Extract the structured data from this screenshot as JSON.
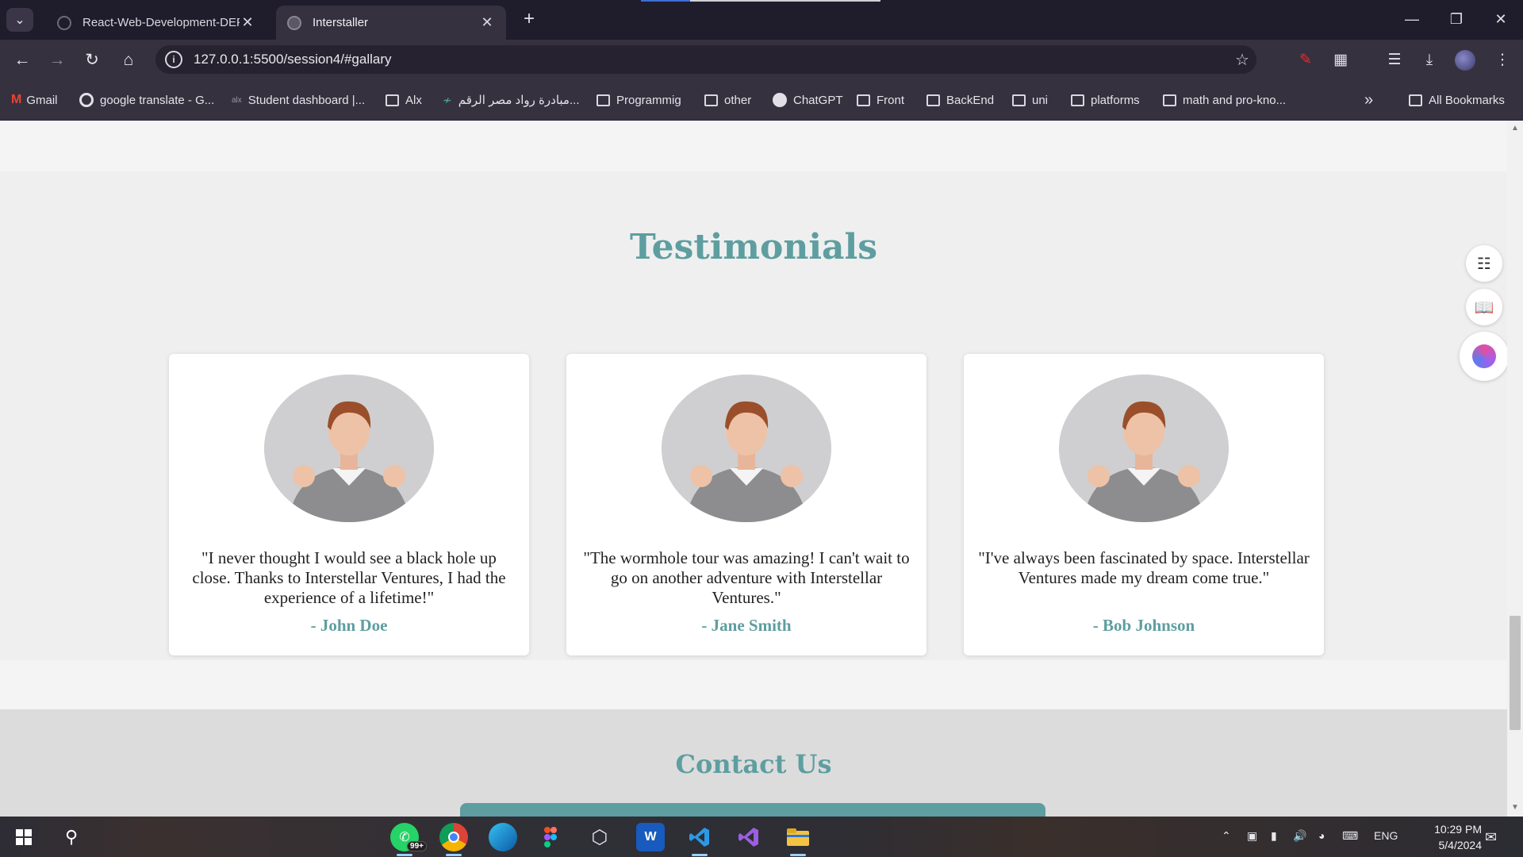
{
  "browser": {
    "tabs": [
      {
        "title": "React-Web-Development-DEPI/",
        "active": false
      },
      {
        "title": "Interstaller",
        "active": true
      }
    ],
    "url": "127.0.0.1:5500/session4/#gallary",
    "bookmarks": [
      {
        "label": "Gmail",
        "icon": "gmail-icon"
      },
      {
        "label": "google translate - G...",
        "icon": "google-icon"
      },
      {
        "label": "Student dashboard |...",
        "icon": "alx-icon"
      },
      {
        "label": "Alx",
        "icon": "folder-icon"
      },
      {
        "label": "مبادرة رواد مصر الرقم...",
        "icon": "site-icon"
      },
      {
        "label": "Programmig",
        "icon": "folder-icon"
      },
      {
        "label": "other",
        "icon": "folder-icon"
      },
      {
        "label": "ChatGPT",
        "icon": "chatgpt-icon"
      },
      {
        "label": "Front",
        "icon": "folder-icon"
      },
      {
        "label": "BackEnd",
        "icon": "folder-icon"
      },
      {
        "label": "uni",
        "icon": "folder-icon"
      },
      {
        "label": "platforms",
        "icon": "folder-icon"
      },
      {
        "label": "math and pro-kno...",
        "icon": "folder-icon"
      }
    ],
    "all_bookmarks": "All Bookmarks",
    "alx_mini_text": "alx",
    "bookmarks_more": "»"
  },
  "page": {
    "testimonials": {
      "title": "Testimonials",
      "items": [
        {
          "quote": "\"I never thought I would see a black hole up close. Thanks to Interstellar Ventures, I had the experience of a lifetime!\"",
          "author": "- John Doe"
        },
        {
          "quote": "\"The wormhole tour was amazing! I can't wait to go on another adventure with Interstellar Ventures.\"",
          "author": "- Jane Smith"
        },
        {
          "quote": "\"I've always been fascinated by space. Interstellar Ventures made my dream come true.\"",
          "author": "- Bob Johnson"
        }
      ]
    },
    "contact": {
      "title": "Contact Us"
    }
  },
  "taskbar": {
    "whatsapp_badge": "99+",
    "word_letter": "W",
    "language": "ENG",
    "time": "10:29 PM",
    "date": "5/4/2024"
  },
  "colors": {
    "accent": "#5e9ea0",
    "tab_strip": "#1f1c2c",
    "toolbar": "#35313f"
  }
}
